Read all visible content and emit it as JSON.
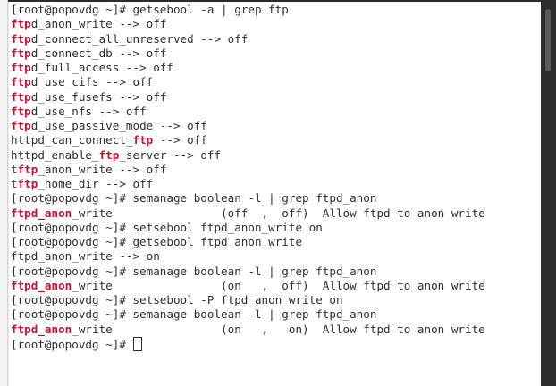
{
  "colors": {
    "terminal_background": "#ffffff",
    "text": "#2e2e2e",
    "match_highlight": "#c8102e",
    "scrollbar": "#2c2c2c"
  },
  "terminal": {
    "lines": [
      [
        {
          "t": "[root@popovdg ~]# getsebool -a | grep ftp"
        }
      ],
      [
        {
          "t": "ftp",
          "hl": true
        },
        {
          "t": "d_anon_write --> off"
        }
      ],
      [
        {
          "t": "ftp",
          "hl": true
        },
        {
          "t": "d_connect_all_unreserved --> off"
        }
      ],
      [
        {
          "t": "ftp",
          "hl": true
        },
        {
          "t": "d_connect_db --> off"
        }
      ],
      [
        {
          "t": "ftp",
          "hl": true
        },
        {
          "t": "d_full_access --> off"
        }
      ],
      [
        {
          "t": "ftp",
          "hl": true
        },
        {
          "t": "d_use_cifs --> off"
        }
      ],
      [
        {
          "t": "ftp",
          "hl": true
        },
        {
          "t": "d_use_fusefs --> off"
        }
      ],
      [
        {
          "t": "ftp",
          "hl": true
        },
        {
          "t": "d_use_nfs --> off"
        }
      ],
      [
        {
          "t": "ftp",
          "hl": true
        },
        {
          "t": "d_use_passive_mode --> off"
        }
      ],
      [
        {
          "t": "httpd_can_connect_"
        },
        {
          "t": "ftp",
          "hl": true
        },
        {
          "t": " --> off"
        }
      ],
      [
        {
          "t": "httpd_enable_"
        },
        {
          "t": "ftp",
          "hl": true
        },
        {
          "t": "_server --> off"
        }
      ],
      [
        {
          "t": "t"
        },
        {
          "t": "ftp",
          "hl": true
        },
        {
          "t": "_anon_write --> off"
        }
      ],
      [
        {
          "t": "t"
        },
        {
          "t": "ftp",
          "hl": true
        },
        {
          "t": "_home_dir --> off"
        }
      ],
      [
        {
          "t": "[root@popovdg ~]# semanage boolean -l | grep ftpd_anon"
        }
      ],
      [
        {
          "t": "ftpd_anon",
          "hl": true
        },
        {
          "t": "_write                (off  ,  off)  Allow ftpd to anon write"
        }
      ],
      [
        {
          "t": "[root@popovdg ~]# setsebool ftpd_anon_write on"
        }
      ],
      [
        {
          "t": "[root@popovdg ~]# getsebool ftpd_anon_write"
        }
      ],
      [
        {
          "t": "ftpd_anon_write --> on"
        }
      ],
      [
        {
          "t": "[root@popovdg ~]# semanage boolean -l | grep ftpd_anon"
        }
      ],
      [
        {
          "t": "ftpd_anon",
          "hl": true
        },
        {
          "t": "_write                (on   ,  off)  Allow ftpd to anon write"
        }
      ],
      [
        {
          "t": "[root@popovdg ~]# setsebool -P ftpd_anon_write on"
        }
      ],
      [
        {
          "t": "[root@popovdg ~]# semanage boolean -l | grep ftpd_anon"
        }
      ],
      [
        {
          "t": "ftpd_anon",
          "hl": true
        },
        {
          "t": "_write                (on   ,   on)  Allow ftpd to anon write"
        }
      ],
      [
        {
          "t": "[root@popovdg ~]# "
        },
        {
          "cursor": true
        }
      ]
    ]
  }
}
